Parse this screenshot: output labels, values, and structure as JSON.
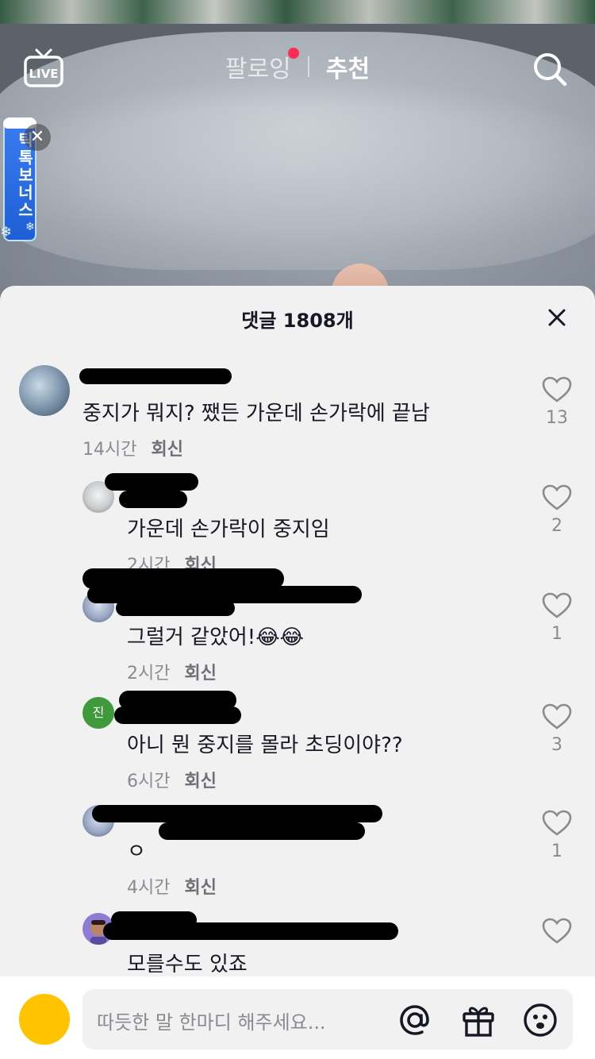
{
  "nav": {
    "live_label": "LIVE",
    "tabs": [
      {
        "label": "팔로잉",
        "has_notification": true
      },
      {
        "label": "추천",
        "active": true
      }
    ]
  },
  "bonus_badge": {
    "label": "틱톡보너스"
  },
  "comments_panel": {
    "title": "댓글 1808개",
    "comments": [
      {
        "text": "중지가 뭐지? 쨌든 가운데 손가락에 끝남",
        "time": "14시간",
        "reply": "회신",
        "likes": "13"
      },
      {
        "text": "가운데 손가락이 중지임",
        "time": "2시간",
        "reply": "회신",
        "likes": "2"
      },
      {
        "text": "그럴거 같았어!😂😂",
        "time": "2시간",
        "reply": "회신",
        "likes": "1"
      },
      {
        "text": "아니 뭔 중지를 몰라 초딩이야??",
        "time": "6시간",
        "reply": "회신",
        "likes": "3",
        "avatar_initial": "진"
      },
      {
        "text": "ㅇ",
        "time": "4시간",
        "reply": "회신",
        "likes": "1"
      },
      {
        "text": "모를수도 있죠",
        "time": "",
        "reply": "",
        "likes": ""
      }
    ]
  },
  "input": {
    "placeholder": "따듯한 말 한마디 해주세요..."
  },
  "colors": {
    "accent_red": "#fe2c55",
    "sheet_bg": "#f1f1f2",
    "my_avatar": "#ffc300",
    "initial_avatar": "#3f9a3c",
    "bonus_blue": "#1e5fd6"
  }
}
